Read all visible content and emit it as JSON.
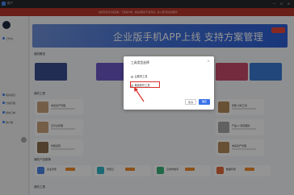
{
  "window": {
    "title": "账户",
    "controls": "— ☐ ✕"
  },
  "notice": {
    "text": "如您有支持方案需求，下载客户端，或在线联系产品专员，进入我们的在线服务"
  },
  "banner": {
    "text": "企业版手机APP上线 支持方案管理"
  },
  "sections": {
    "overview": "我的概览",
    "tools": "我的工具",
    "apps": "我的产品推荐",
    "more": "我的工具"
  },
  "sidebar": {
    "items": [
      "工作台",
      "我的项目",
      "方案管理",
      "我的订单",
      "客户端"
    ]
  },
  "small_cards": {
    "colors": [
      "#3c4f8f",
      "#6e59c9",
      "#3f6fd8",
      "#c84a6b",
      "#3a7bd5",
      "#3f6fd8"
    ]
  },
  "tools": [
    {
      "label": "未来资产管理"
    },
    {
      "label": "云平台管理"
    },
    {
      "label": "智能运营"
    },
    {
      "label": "运维管理助手"
    },
    {
      "label": "数据治理平台"
    },
    {
      "label": "智能 分析工具"
    },
    {
      "label": "产品 & 项目跟踪"
    },
    {
      "label": "未来资产管理"
    }
  ],
  "apps": [
    {
      "label": "企业管家"
    },
    {
      "label": "智慧云"
    },
    {
      "label": "云协作助手"
    },
    {
      "label": "数据管家"
    }
  ],
  "dialog": {
    "title": "工具类型选择",
    "close": "×",
    "options": [
      "云服务工具",
      "离线软件工具"
    ],
    "cancel_label": "取消",
    "ok_label": "确定"
  },
  "colors": {
    "accent": "#3a73e8",
    "notice_bg": "#b7362c",
    "highlight": "#d8312a"
  }
}
